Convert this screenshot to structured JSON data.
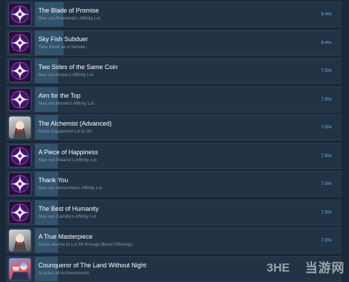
{
  "achievements": [
    {
      "title": "The Blade of Promise",
      "description": "Max out Ruenheid's Affinity Lvl.",
      "percent": "9.4%",
      "icon": "purple-sigil-icon",
      "fill": 0.094
    },
    {
      "title": "Sky Fish Subduer",
      "description": "Take Perle as a Servan.",
      "percent": "9.4%",
      "icon": "purple-sigil-icon",
      "fill": 0.094
    },
    {
      "title": "Two Sides of the Same Coin",
      "description": "Max out Amice's Affinity Lvl.",
      "percent": "7.5%",
      "icon": "purple-sigil-icon",
      "fill": 0.075
    },
    {
      "title": "Aim for the Top",
      "description": "Max out Moveil's Affinity Lvl.",
      "percent": "7.5%",
      "icon": "purple-sigil-icon",
      "fill": 0.075
    },
    {
      "title": "The Alchemist (Advanced)",
      "description": "Raise Equipment Lvl to 30.",
      "percent": "7.5%",
      "icon": "character-portrait-icon",
      "fill": 0.075
    },
    {
      "title": "A Piece of Happiness",
      "description": "Max out Eleanor's Affinity Lvl.",
      "percent": "7.5%",
      "icon": "purple-sigil-icon",
      "fill": 0.075
    },
    {
      "title": "Thank You",
      "description": "Max out Veruschka's Affinity Lvl.",
      "percent": "7.5%",
      "icon": "purple-sigil-icon",
      "fill": 0.075
    },
    {
      "title": "The Best of Humanity",
      "description": "Max out Camilla's Affinity Lvl.",
      "percent": "7.5%",
      "icon": "purple-sigil-icon",
      "fill": 0.075
    },
    {
      "title": "A True Masterpiece",
      "description": "Raise Aluche to Lvl 50 through Blood Offerings.",
      "percent": "7.5%",
      "icon": "character-portrait-icon",
      "fill": 0.075
    },
    {
      "title": "Counqueror of The Land Without Night",
      "description": "Acquire all Achievements.",
      "percent": "",
      "icon": "group-portrait-icon",
      "fill": 0.075
    }
  ],
  "watermark": {
    "text": "当游网",
    "brand": "3HE"
  },
  "colors": {
    "background": "#1b2838",
    "row": "#223345",
    "progress_fill": "#31536d",
    "title": "#ffffff",
    "description": "#8f98a0",
    "percent": "#66c0f4"
  }
}
